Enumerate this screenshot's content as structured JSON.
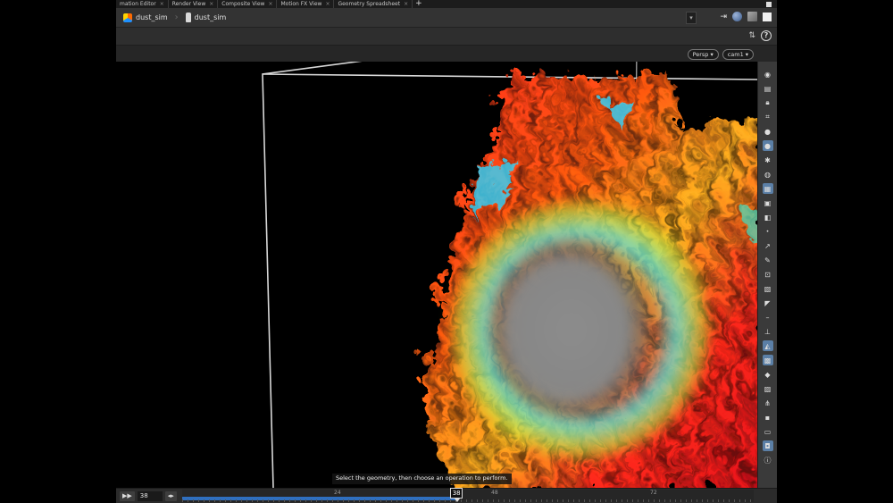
{
  "tabs": [
    {
      "label": "mation Editor"
    },
    {
      "label": "Render View"
    },
    {
      "label": "Composite View"
    },
    {
      "label": "Motion FX View"
    },
    {
      "label": "Geometry Spreadsheet"
    }
  ],
  "path": {
    "network": "dust_sim",
    "node": "dust_sim"
  },
  "viewport": {
    "view_mode": "Persp",
    "camera": "cam1",
    "prompt": "Select the geometry, then choose an operation to perform."
  },
  "timeline": {
    "current_frame": "38",
    "cursor_label": "38",
    "tick_labels": [
      "24",
      "48",
      "72"
    ],
    "progress": 0.48
  },
  "icons": {
    "tab_close": "×",
    "tab_add": "+"
  },
  "colors": {
    "accent": "#2f6fbf",
    "active_tool": "#5b7fa6"
  }
}
